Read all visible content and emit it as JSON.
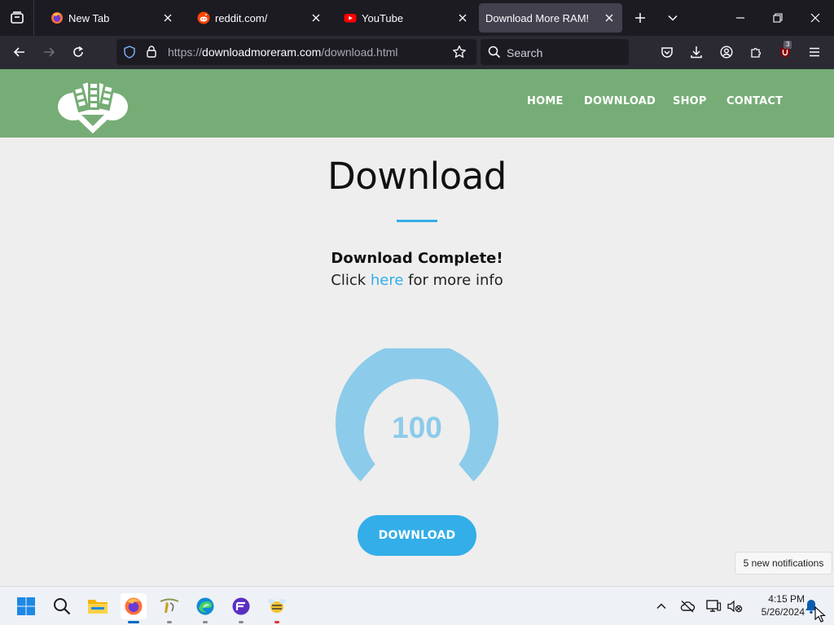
{
  "browser": {
    "tabs": [
      {
        "label": "New Tab",
        "favicon": "firefox-icon",
        "active": false
      },
      {
        "label": "reddit.com/",
        "favicon": "reddit-icon",
        "active": false
      },
      {
        "label": "YouTube",
        "favicon": "youtube-icon",
        "active": false
      },
      {
        "label": "Download More RAM!",
        "favicon": "",
        "active": true
      }
    ],
    "url_prefix": "https://",
    "url_domain": "downloadmoreram.com",
    "url_path": "/download.html",
    "search_placeholder": "Search",
    "extension_badge": "3"
  },
  "site": {
    "menu": [
      "HOME",
      "DOWNLOAD",
      "SHOP",
      "CONTACT"
    ],
    "page_title": "Download",
    "status_heading": "Download Complete!",
    "info_prefix": "Click ",
    "info_link": "here",
    "info_suffix": " for more info",
    "gauge_value": "100",
    "download_button": "DOWNLOAD",
    "colors": {
      "header": "#76ad76",
      "accent": "#33aee8",
      "gauge": "#8ccbea"
    }
  },
  "notification_toast": "5 new notifications",
  "taskbar": {
    "apps": [
      "start-icon",
      "search-icon",
      "file-explorer-icon",
      "firefox-icon",
      "app-icon",
      "edge-icon",
      "app-icon",
      "app-icon"
    ],
    "time": "4:15 PM",
    "date": "5/26/2024"
  }
}
